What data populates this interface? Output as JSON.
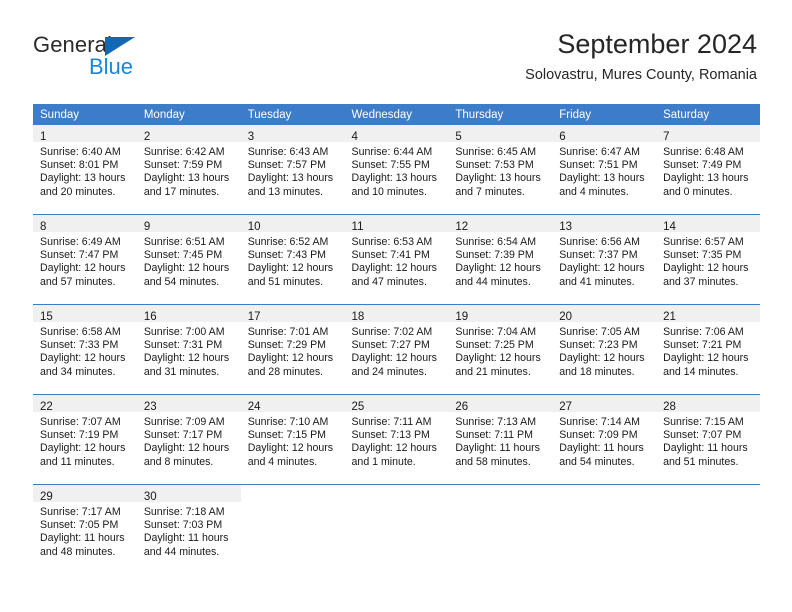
{
  "brand": {
    "name_part1": "General",
    "name_part2": "Blue",
    "logo_icon": "triangle-icon",
    "accent_color": "#1787d6",
    "dark_color": "#2b2b2b"
  },
  "header": {
    "title": "September 2024",
    "subtitle": "Solovastru, Mures County, Romania"
  },
  "theme": {
    "header_row_bg": "#3d7cc9",
    "daynum_bg": "#f0f0f0",
    "row_divider": "#3d7cc9",
    "text": "#1a1a1a"
  },
  "weekdays": [
    "Sunday",
    "Monday",
    "Tuesday",
    "Wednesday",
    "Thursday",
    "Friday",
    "Saturday"
  ],
  "weeks": [
    [
      {
        "day": "1",
        "sunrise": "Sunrise: 6:40 AM",
        "sunset": "Sunset: 8:01 PM",
        "daylight1": "Daylight: 13 hours",
        "daylight2": "and 20 minutes."
      },
      {
        "day": "2",
        "sunrise": "Sunrise: 6:42 AM",
        "sunset": "Sunset: 7:59 PM",
        "daylight1": "Daylight: 13 hours",
        "daylight2": "and 17 minutes."
      },
      {
        "day": "3",
        "sunrise": "Sunrise: 6:43 AM",
        "sunset": "Sunset: 7:57 PM",
        "daylight1": "Daylight: 13 hours",
        "daylight2": "and 13 minutes."
      },
      {
        "day": "4",
        "sunrise": "Sunrise: 6:44 AM",
        "sunset": "Sunset: 7:55 PM",
        "daylight1": "Daylight: 13 hours",
        "daylight2": "and 10 minutes."
      },
      {
        "day": "5",
        "sunrise": "Sunrise: 6:45 AM",
        "sunset": "Sunset: 7:53 PM",
        "daylight1": "Daylight: 13 hours",
        "daylight2": "and 7 minutes."
      },
      {
        "day": "6",
        "sunrise": "Sunrise: 6:47 AM",
        "sunset": "Sunset: 7:51 PM",
        "daylight1": "Daylight: 13 hours",
        "daylight2": "and 4 minutes."
      },
      {
        "day": "7",
        "sunrise": "Sunrise: 6:48 AM",
        "sunset": "Sunset: 7:49 PM",
        "daylight1": "Daylight: 13 hours",
        "daylight2": "and 0 minutes."
      }
    ],
    [
      {
        "day": "8",
        "sunrise": "Sunrise: 6:49 AM",
        "sunset": "Sunset: 7:47 PM",
        "daylight1": "Daylight: 12 hours",
        "daylight2": "and 57 minutes."
      },
      {
        "day": "9",
        "sunrise": "Sunrise: 6:51 AM",
        "sunset": "Sunset: 7:45 PM",
        "daylight1": "Daylight: 12 hours",
        "daylight2": "and 54 minutes."
      },
      {
        "day": "10",
        "sunrise": "Sunrise: 6:52 AM",
        "sunset": "Sunset: 7:43 PM",
        "daylight1": "Daylight: 12 hours",
        "daylight2": "and 51 minutes."
      },
      {
        "day": "11",
        "sunrise": "Sunrise: 6:53 AM",
        "sunset": "Sunset: 7:41 PM",
        "daylight1": "Daylight: 12 hours",
        "daylight2": "and 47 minutes."
      },
      {
        "day": "12",
        "sunrise": "Sunrise: 6:54 AM",
        "sunset": "Sunset: 7:39 PM",
        "daylight1": "Daylight: 12 hours",
        "daylight2": "and 44 minutes."
      },
      {
        "day": "13",
        "sunrise": "Sunrise: 6:56 AM",
        "sunset": "Sunset: 7:37 PM",
        "daylight1": "Daylight: 12 hours",
        "daylight2": "and 41 minutes."
      },
      {
        "day": "14",
        "sunrise": "Sunrise: 6:57 AM",
        "sunset": "Sunset: 7:35 PM",
        "daylight1": "Daylight: 12 hours",
        "daylight2": "and 37 minutes."
      }
    ],
    [
      {
        "day": "15",
        "sunrise": "Sunrise: 6:58 AM",
        "sunset": "Sunset: 7:33 PM",
        "daylight1": "Daylight: 12 hours",
        "daylight2": "and 34 minutes."
      },
      {
        "day": "16",
        "sunrise": "Sunrise: 7:00 AM",
        "sunset": "Sunset: 7:31 PM",
        "daylight1": "Daylight: 12 hours",
        "daylight2": "and 31 minutes."
      },
      {
        "day": "17",
        "sunrise": "Sunrise: 7:01 AM",
        "sunset": "Sunset: 7:29 PM",
        "daylight1": "Daylight: 12 hours",
        "daylight2": "and 28 minutes."
      },
      {
        "day": "18",
        "sunrise": "Sunrise: 7:02 AM",
        "sunset": "Sunset: 7:27 PM",
        "daylight1": "Daylight: 12 hours",
        "daylight2": "and 24 minutes."
      },
      {
        "day": "19",
        "sunrise": "Sunrise: 7:04 AM",
        "sunset": "Sunset: 7:25 PM",
        "daylight1": "Daylight: 12 hours",
        "daylight2": "and 21 minutes."
      },
      {
        "day": "20",
        "sunrise": "Sunrise: 7:05 AM",
        "sunset": "Sunset: 7:23 PM",
        "daylight1": "Daylight: 12 hours",
        "daylight2": "and 18 minutes."
      },
      {
        "day": "21",
        "sunrise": "Sunrise: 7:06 AM",
        "sunset": "Sunset: 7:21 PM",
        "daylight1": "Daylight: 12 hours",
        "daylight2": "and 14 minutes."
      }
    ],
    [
      {
        "day": "22",
        "sunrise": "Sunrise: 7:07 AM",
        "sunset": "Sunset: 7:19 PM",
        "daylight1": "Daylight: 12 hours",
        "daylight2": "and 11 minutes."
      },
      {
        "day": "23",
        "sunrise": "Sunrise: 7:09 AM",
        "sunset": "Sunset: 7:17 PM",
        "daylight1": "Daylight: 12 hours",
        "daylight2": "and 8 minutes."
      },
      {
        "day": "24",
        "sunrise": "Sunrise: 7:10 AM",
        "sunset": "Sunset: 7:15 PM",
        "daylight1": "Daylight: 12 hours",
        "daylight2": "and 4 minutes."
      },
      {
        "day": "25",
        "sunrise": "Sunrise: 7:11 AM",
        "sunset": "Sunset: 7:13 PM",
        "daylight1": "Daylight: 12 hours",
        "daylight2": "and 1 minute."
      },
      {
        "day": "26",
        "sunrise": "Sunrise: 7:13 AM",
        "sunset": "Sunset: 7:11 PM",
        "daylight1": "Daylight: 11 hours",
        "daylight2": "and 58 minutes."
      },
      {
        "day": "27",
        "sunrise": "Sunrise: 7:14 AM",
        "sunset": "Sunset: 7:09 PM",
        "daylight1": "Daylight: 11 hours",
        "daylight2": "and 54 minutes."
      },
      {
        "day": "28",
        "sunrise": "Sunrise: 7:15 AM",
        "sunset": "Sunset: 7:07 PM",
        "daylight1": "Daylight: 11 hours",
        "daylight2": "and 51 minutes."
      }
    ],
    [
      {
        "day": "29",
        "sunrise": "Sunrise: 7:17 AM",
        "sunset": "Sunset: 7:05 PM",
        "daylight1": "Daylight: 11 hours",
        "daylight2": "and 48 minutes."
      },
      {
        "day": "30",
        "sunrise": "Sunrise: 7:18 AM",
        "sunset": "Sunset: 7:03 PM",
        "daylight1": "Daylight: 11 hours",
        "daylight2": "and 44 minutes."
      },
      {
        "day": "",
        "sunrise": "",
        "sunset": "",
        "daylight1": "",
        "daylight2": ""
      },
      {
        "day": "",
        "sunrise": "",
        "sunset": "",
        "daylight1": "",
        "daylight2": ""
      },
      {
        "day": "",
        "sunrise": "",
        "sunset": "",
        "daylight1": "",
        "daylight2": ""
      },
      {
        "day": "",
        "sunrise": "",
        "sunset": "",
        "daylight1": "",
        "daylight2": ""
      },
      {
        "day": "",
        "sunrise": "",
        "sunset": "",
        "daylight1": "",
        "daylight2": ""
      }
    ]
  ]
}
